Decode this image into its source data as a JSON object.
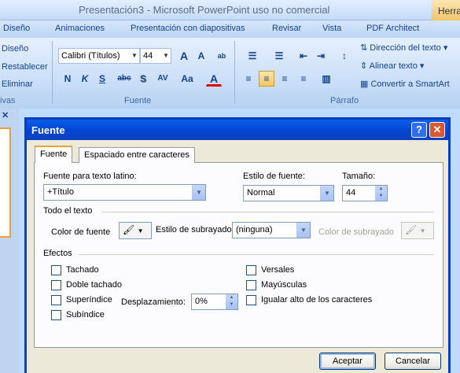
{
  "app": {
    "title": "Presentación3 - Microsoft PowerPoint uso no comercial",
    "context_tab": "Herra"
  },
  "ribbon": {
    "tabs": [
      "Diseño",
      "Animaciones",
      "Presentación con diapositivas",
      "Revisar",
      "Vista",
      "PDF Architect"
    ],
    "diapositivas": {
      "items": [
        "Diseño",
        "Restablecer",
        "Eliminar"
      ],
      "group_label": "ivas"
    },
    "fuente": {
      "font_name": "Calibri (Títulos)",
      "font_size": "44",
      "group_label": "Fuente",
      "icons": [
        "N",
        "K",
        "S",
        "abc",
        "S",
        "AV",
        "Aa",
        "A"
      ]
    },
    "parrafo": {
      "group_label": "Párrafo",
      "items": [
        "Dirección del texto",
        "Alinear texto",
        "Convertir a SmartArt"
      ]
    }
  },
  "dialog": {
    "title": "Fuente",
    "help": "?",
    "close": "✕",
    "tabs": [
      "Fuente",
      "Espaciado entre caracteres"
    ],
    "latin_font_label": "Fuente para texto latino:",
    "latin_font_value": "+Título",
    "style_label": "Estilo de fuente:",
    "style_value": "Normal",
    "size_label": "Tamaño:",
    "size_value": "44",
    "all_text_label": "Todo el texto",
    "font_color_label": "Color de fuente",
    "underline_style_label": "Estilo de subrayado",
    "underline_style_value": "(ninguna)",
    "underline_color_label": "Color de subrayado",
    "effects_label": "Efectos",
    "effects_left": [
      "Tachado",
      "Doble tachado",
      "Superíndice",
      "Subíndice"
    ],
    "effects_right": [
      "Versales",
      "Mayúsculas",
      "Igualar alto de los caracteres"
    ],
    "offset_label": "Desplazamiento:",
    "offset_value": "0%",
    "accept": "Aceptar",
    "cancel": "Cancelar"
  }
}
